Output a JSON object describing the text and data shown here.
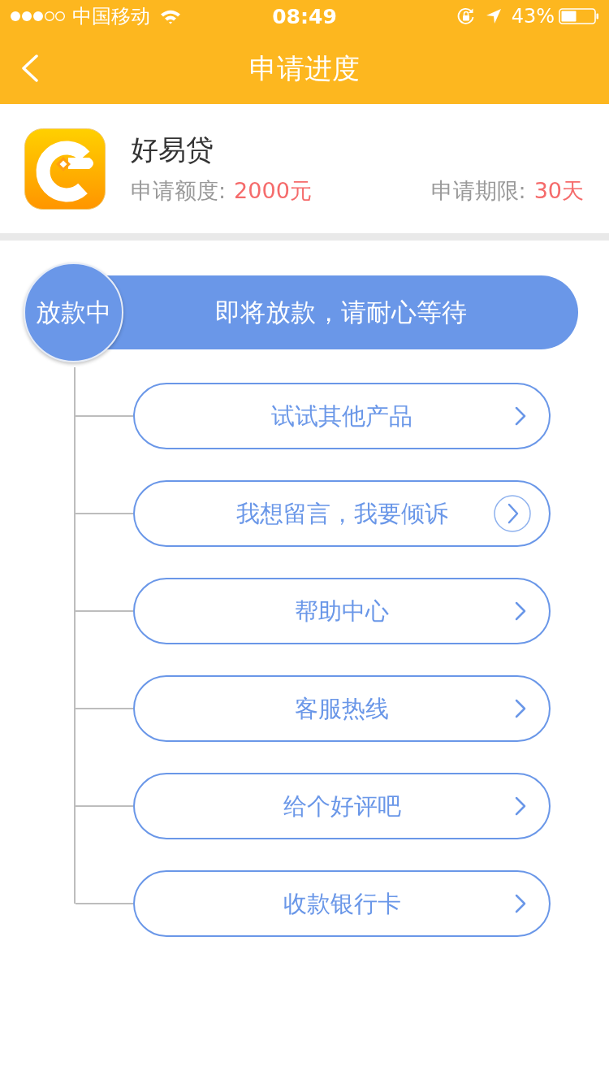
{
  "status_bar": {
    "carrier": "中国移动",
    "time": "08:49",
    "battery": "43%"
  },
  "nav_bar": {
    "title": "申请进度"
  },
  "loan": {
    "name": "好易贷",
    "amount_label": "申请额度:",
    "amount": "2000元",
    "term_label": "申请期限:",
    "term": "30天"
  },
  "progress": {
    "status": "放款中",
    "message": "即将放款，请耐心等待"
  },
  "actions": [
    {
      "label": "试试其他产品",
      "kind": "plain"
    },
    {
      "label": "我想留言，我要倾诉",
      "kind": "circled"
    },
    {
      "label": "帮助中心",
      "kind": "plain"
    },
    {
      "label": "客服热线",
      "kind": "plain"
    },
    {
      "label": "给个好评吧",
      "kind": "plain"
    },
    {
      "label": "收款银行卡",
      "kind": "plain"
    }
  ]
}
